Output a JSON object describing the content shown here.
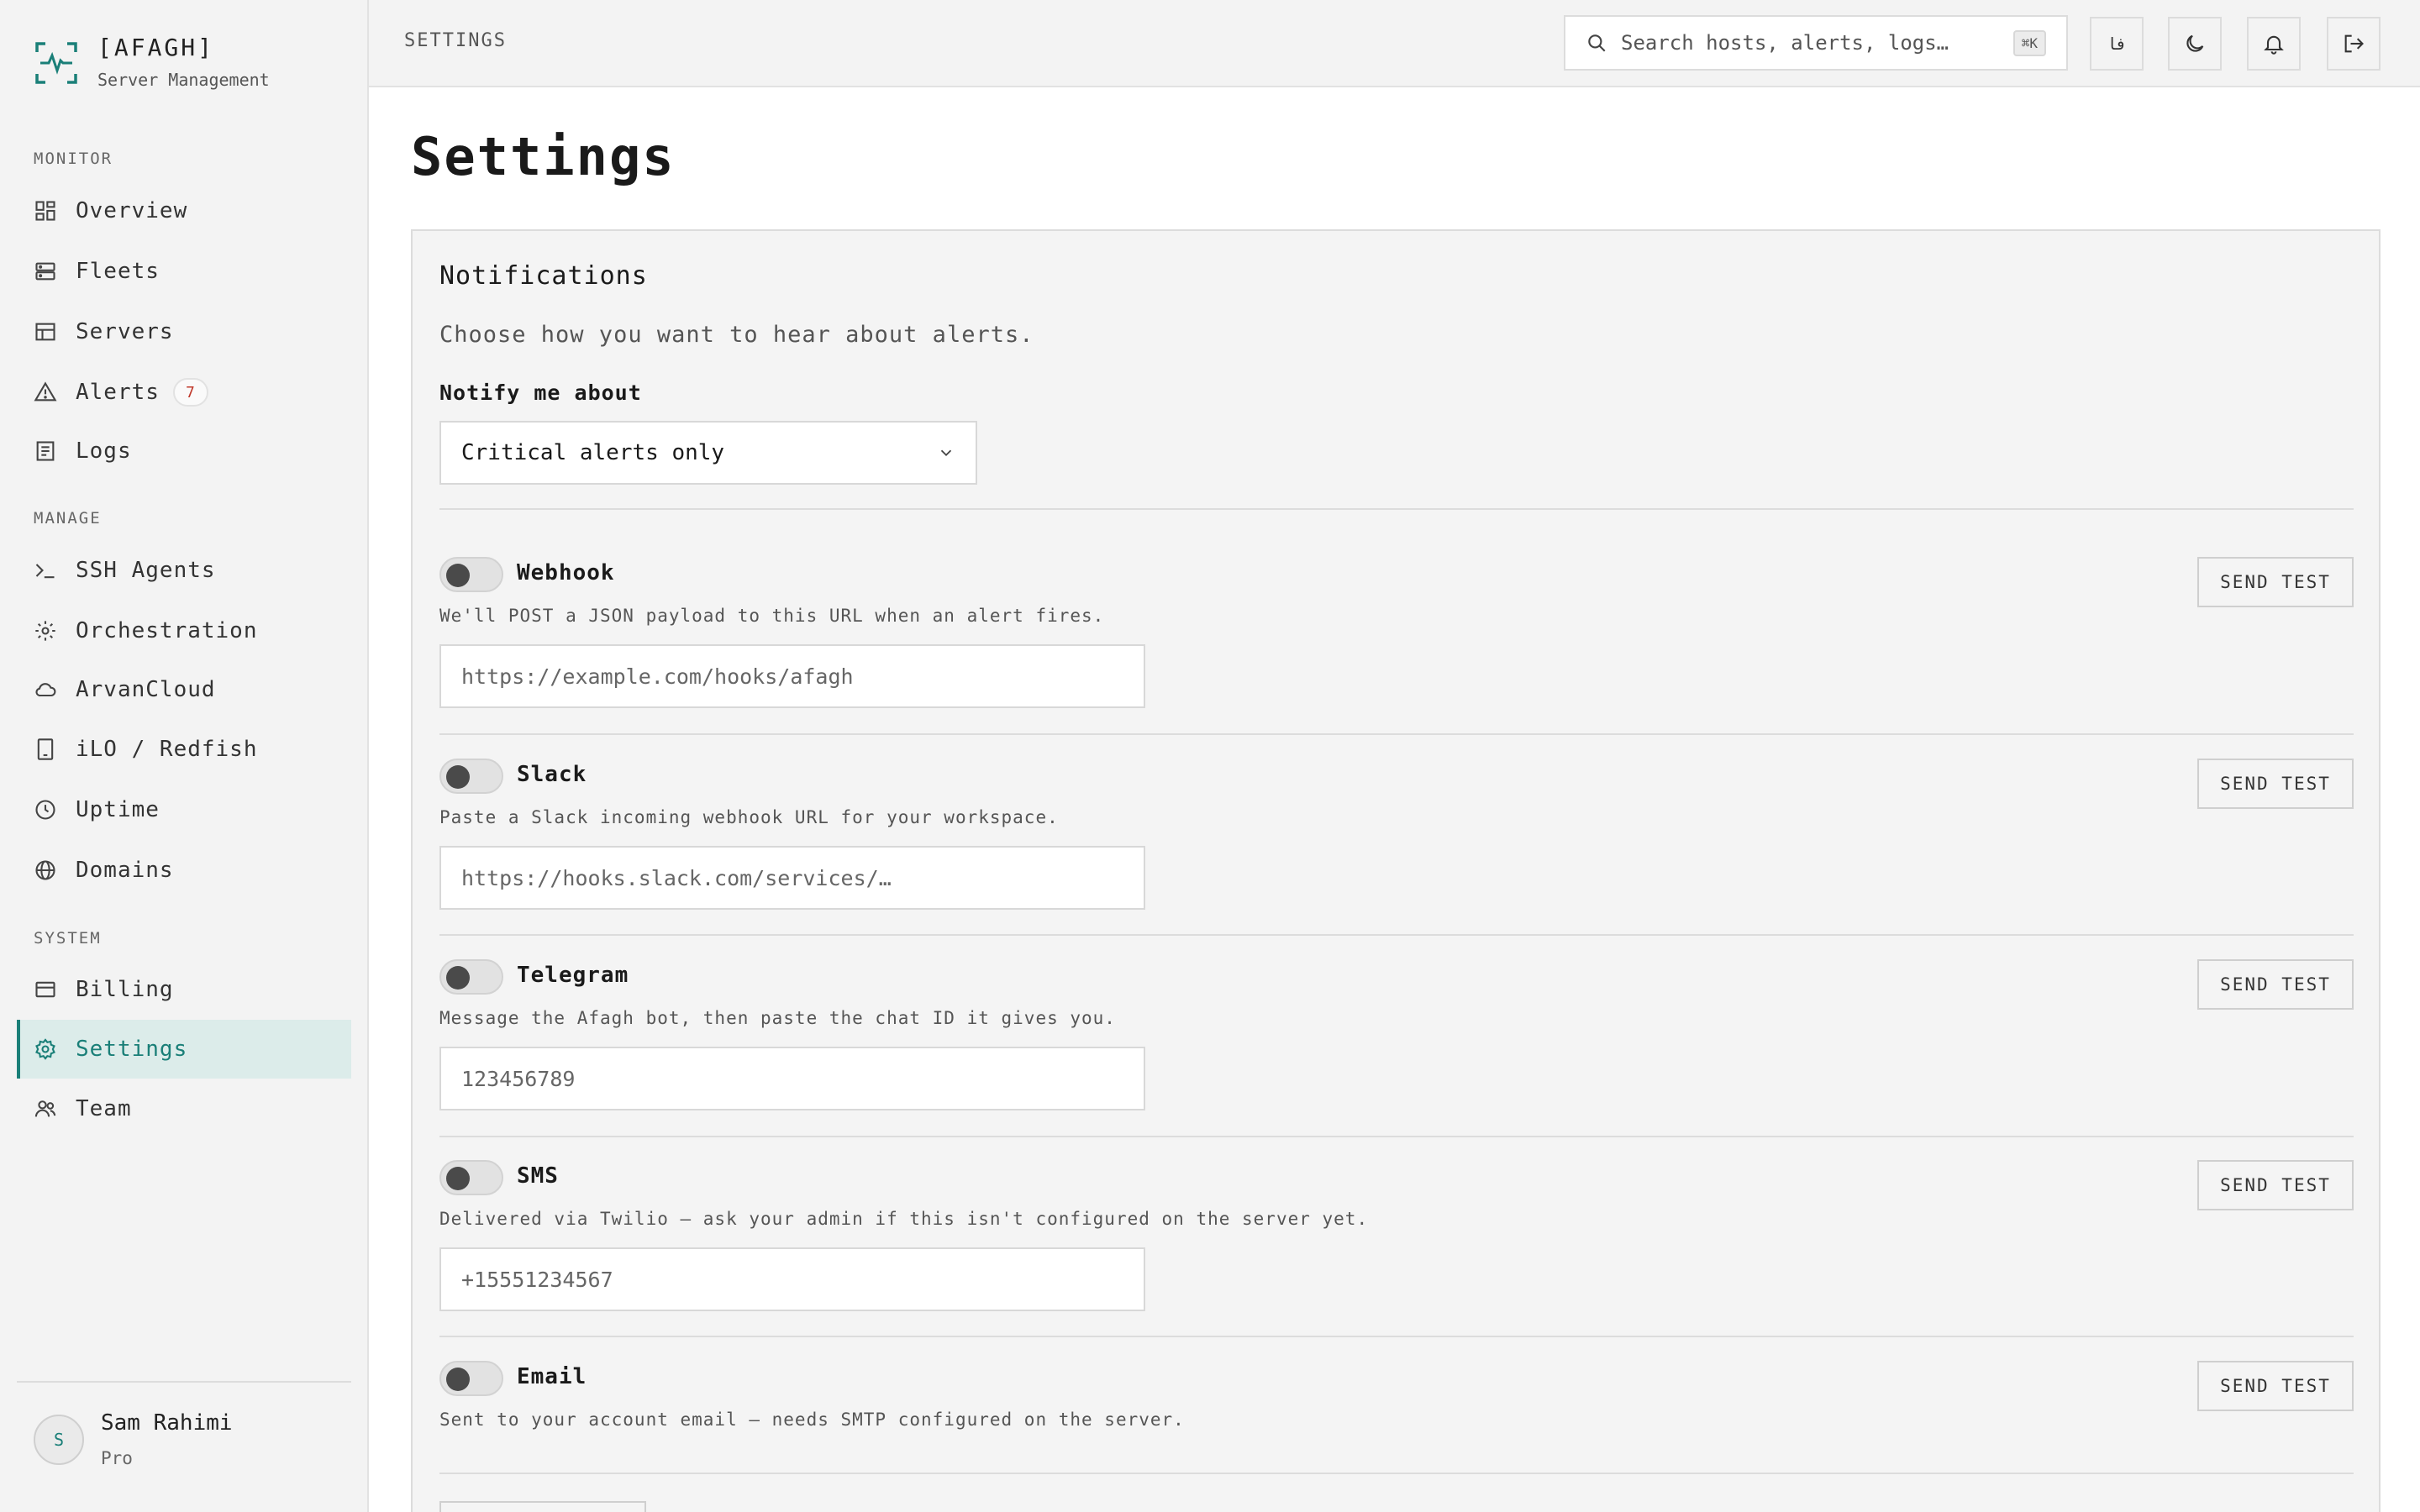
{
  "brand": {
    "name": "[AFAGH]",
    "subtitle": "Server Management"
  },
  "sidebar": {
    "sections": [
      {
        "label": "MONITOR"
      },
      {
        "label": "MANAGE"
      },
      {
        "label": "SYSTEM"
      }
    ],
    "items": [
      {
        "label": "Overview",
        "icon": "dashboard-icon"
      },
      {
        "label": "Fleets",
        "icon": "fleets-icon"
      },
      {
        "label": "Servers",
        "icon": "servers-icon"
      },
      {
        "label": "Alerts",
        "icon": "alert-triangle-icon",
        "badge": "7"
      },
      {
        "label": "Logs",
        "icon": "logs-icon"
      },
      {
        "label": "SSH Agents",
        "icon": "terminal-icon"
      },
      {
        "label": "Orchestration",
        "icon": "orchestration-icon"
      },
      {
        "label": "ArvanCloud",
        "icon": "cloud-icon"
      },
      {
        "label": "iLO / Redfish",
        "icon": "device-icon"
      },
      {
        "label": "Uptime",
        "icon": "clock-icon"
      },
      {
        "label": "Domains",
        "icon": "globe-icon"
      },
      {
        "label": "Billing",
        "icon": "credit-card-icon"
      },
      {
        "label": "Settings",
        "icon": "gear-icon",
        "active": true
      },
      {
        "label": "Team",
        "icon": "team-icon"
      }
    ]
  },
  "user": {
    "initial": "S",
    "name": "Sam Rahimi",
    "plan": "Pro"
  },
  "topbar": {
    "breadcrumb": "SETTINGS",
    "search_placeholder": "Search hosts, alerts, logs…",
    "search_shortcut": "⌘K",
    "language_label": "فا"
  },
  "page": {
    "title": "Settings"
  },
  "notifications": {
    "title": "Notifications",
    "description": "Choose how you want to hear about alerts.",
    "notify_label": "Notify me about",
    "notify_value": "Critical alerts only",
    "send_test_label": "SEND TEST",
    "channels": [
      {
        "name": "Webhook",
        "description": "We'll POST a JSON payload to this URL when an alert fires.",
        "placeholder": "https://example.com/hooks/afagh",
        "enabled": false
      },
      {
        "name": "Slack",
        "description": "Paste a Slack incoming webhook URL for your workspace.",
        "placeholder": "https://hooks.slack.com/services/…",
        "enabled": false
      },
      {
        "name": "Telegram",
        "description": "Message the Afagh bot, then paste the chat ID it gives you.",
        "placeholder": "123456789",
        "enabled": false
      },
      {
        "name": "SMS",
        "description": "Delivered via Twilio — ask your admin if this isn't configured on the server yet.",
        "placeholder": "+15551234567",
        "enabled": false
      },
      {
        "name": "Email",
        "description": "Sent to your account email — needs SMTP configured on the server.",
        "enabled": false
      }
    ]
  },
  "colors": {
    "accent": "#1a7f78",
    "badge_text": "#c0392b"
  }
}
